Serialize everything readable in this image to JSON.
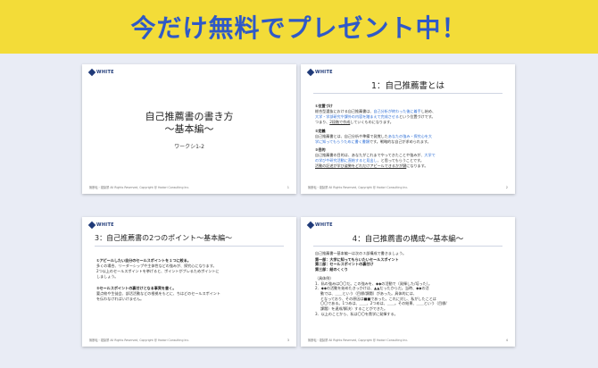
{
  "banner": {
    "text": "今だけ無料でプレゼント中！",
    "bg": "#f3dc38",
    "color": "#2f59c7"
  },
  "logo": {
    "text": "WHITE"
  },
  "footer": {
    "text": "無断転・複製禁 All Rights Reserved, Copyright @ Hodori Consulting Inc."
  },
  "slide1": {
    "title_line1": "自己推薦書の書き方",
    "title_line2": "〜基本編〜",
    "subtitle": "ワークシ1-2",
    "page": "1"
  },
  "slide2": {
    "title": "1：自己推薦書とは",
    "page": "2",
    "s1_head": "①位置づけ",
    "s1_l1a": "総合型選抜における自己推薦書は、",
    "s1_l1b": "自己分析が終わった後に着手",
    "s1_l1c": "し始め、",
    "s1_l2a": "大学・学部研究や課外の内容を踏まえて完成させる",
    "s1_l2b": "という位置づけです。",
    "s1_l3a": "つまり、",
    "s1_l3b": "2段階で作成",
    "s1_l3c": "していくものになります。",
    "s2_head": "②定義",
    "s2_l1a": "自己推薦書とは、自己分析や準備で発覚した",
    "s2_l1b": "あなたの強み・探究心を大",
    "s2_l2a": "学に知ってもらうために書く書類",
    "s2_l2b": "です。戦略的な自己が求められます。",
    "s3_head": "③目的",
    "s3_l1a": "自己推薦書の目的は、あなたがこれまでやってきたことや強みが、",
    "s3_l1b": "大学で",
    "s3_l2a": "の学びや研究活動に直結すると見出し",
    "s3_l2b": "、と思ってもらうことです。",
    "s3_l3a": "活動の記述が学び姿勢をどれだけアピールできるかが鍵",
    "s3_l3b": "になります。"
  },
  "slide3": {
    "title": "3：自己推薦書の2つのポイント〜基本編〜",
    "page": "3",
    "p1_head": "①アピールしたい自分のセールスポイントを１つに絞る。",
    "p1_l1": "多くの場合、リーダーシップや主体性などの強みが、探究心になります。",
    "p1_l2": "2つ以上のセールスポイントを挙げると、ポイントがブレるためポイントに",
    "p1_l3": "しましょう。",
    "p2_head": "②セールスポイントの裏付けとなる事実を書く。",
    "p2_l1": "要点絞や生徒会、部活活動などの根拠をもとに、ちはどのセールスポイント",
    "p2_l2": "を伝わなければいけません。"
  },
  "slide4": {
    "title": "4：自己推薦書の構成〜基本編〜",
    "page": "4",
    "intro": "自己推薦書〜基本編〜は次の３部構成で書きましょう。",
    "part1": "第一部：大学に知ってもらいたいセールスポイント",
    "part2": "第二部：セールスポイントの裏付け",
    "part3": "第三部：結のくくり",
    "ex_head": "（具体例）",
    "ex1": "1．私の強みは〇〇だ。この強みを、◆◆の活動で（発揮した/培った）。",
    "ex2a": "2．◆◆の活動を始めたきっかけは、▲▲だったからだ。当時、◆◆の活",
    "ex2b": "動では、＿＿という（目標/課題）があった。具体的には、",
    "ex2c": "となっており、その原因は■■であった。これに対し、私がしたことは",
    "ex2d": "〇〇である。1つめは、＿＿、2つめは、＿＿。その結果、＿＿という（目標/",
    "ex2e": "課題）を達成/解決）することができた。",
    "ex3": "3．以上のことから、私は〇〇を貴学に発揮する。"
  }
}
